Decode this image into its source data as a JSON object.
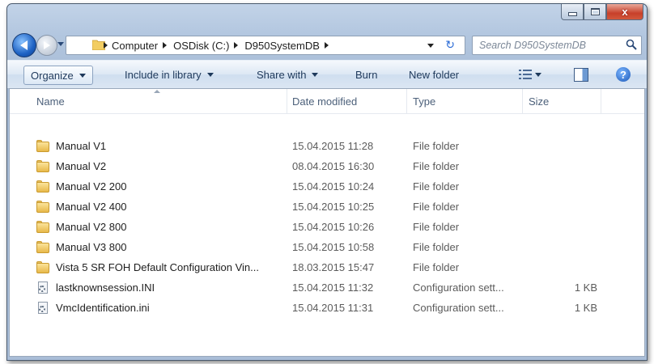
{
  "window": {
    "caption_buttons": {
      "minimize_icon": "minimize-icon",
      "maximize_icon": "maximize-icon",
      "close_glyph": "x"
    }
  },
  "nav": {
    "breadcrumbs": [
      "Computer",
      "OSDisk (C:)",
      "D950SystemDB"
    ],
    "search_placeholder": "Search D950SystemDB",
    "refresh_glyph": "↻"
  },
  "toolbar": {
    "organize": "Organize",
    "include_in_library": "Include in library",
    "share_with": "Share with",
    "burn": "Burn",
    "new_folder": "New folder",
    "help_glyph": "?"
  },
  "columns": {
    "name": "Name",
    "date_modified": "Date modified",
    "type": "Type",
    "size": "Size"
  },
  "files": [
    {
      "name": "Manual V1",
      "date": "15.04.2015 11:28",
      "type": "File folder",
      "size": "",
      "icon": "folder-icon"
    },
    {
      "name": "Manual V2",
      "date": "08.04.2015 16:30",
      "type": "File folder",
      "size": "",
      "icon": "folder-icon"
    },
    {
      "name": "Manual V2 200",
      "date": "15.04.2015 10:24",
      "type": "File folder",
      "size": "",
      "icon": "folder-icon"
    },
    {
      "name": "Manual V2 400",
      "date": "15.04.2015 10:25",
      "type": "File folder",
      "size": "",
      "icon": "folder-icon"
    },
    {
      "name": "Manual V2 800",
      "date": "15.04.2015 10:26",
      "type": "File folder",
      "size": "",
      "icon": "folder-icon"
    },
    {
      "name": "Manual V3 800",
      "date": "15.04.2015 10:58",
      "type": "File folder",
      "size": "",
      "icon": "folder-icon"
    },
    {
      "name": "Vista 5 SR FOH Default Configuration Vin...",
      "date": "18.03.2015 15:47",
      "type": "File folder",
      "size": "",
      "icon": "folder-icon"
    },
    {
      "name": "lastknownsession.INI",
      "date": "15.04.2015 11:32",
      "type": "Configuration sett...",
      "size": "1 KB",
      "icon": "ini-file-icon"
    },
    {
      "name": "VmcIdentification.ini",
      "date": "15.04.2015 11:31",
      "type": "Configuration sett...",
      "size": "1 KB",
      "icon": "ini-file-icon"
    }
  ]
}
